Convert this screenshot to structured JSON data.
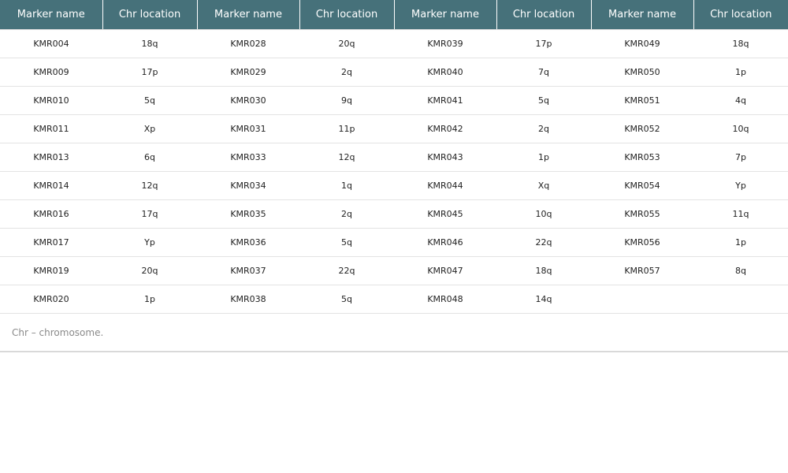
{
  "table": {
    "headers": [
      "Marker name",
      "Chr location",
      "Marker name",
      "Chr location",
      "Marker name",
      "Chr location",
      "Marker name",
      "Chr location"
    ],
    "rows": [
      [
        "KMR004",
        "18q",
        "KMR028",
        "20q",
        "KMR039",
        "17p",
        "KMR049",
        "18q"
      ],
      [
        "KMR009",
        "17p",
        "KMR029",
        "2q",
        "KMR040",
        "7q",
        "KMR050",
        "1p"
      ],
      [
        "KMR010",
        "5q",
        "KMR030",
        "9q",
        "KMR041",
        "5q",
        "KMR051",
        "4q"
      ],
      [
        "KMR011",
        "Xp",
        "KMR031",
        "11p",
        "KMR042",
        "2q",
        "KMR052",
        "10q"
      ],
      [
        "KMR013",
        "6q",
        "KMR033",
        "12q",
        "KMR043",
        "1p",
        "KMR053",
        "7p"
      ],
      [
        "KMR014",
        "12q",
        "KMR034",
        "1q",
        "KMR044",
        "Xq",
        "KMR054",
        "Yp"
      ],
      [
        "KMR016",
        "17q",
        "KMR035",
        "2q",
        "KMR045",
        "10q",
        "KMR055",
        "11q"
      ],
      [
        "KMR017",
        "Yp",
        "KMR036",
        "5q",
        "KMR046",
        "22q",
        "KMR056",
        "1p"
      ],
      [
        "KMR019",
        "20q",
        "KMR037",
        "22q",
        "KMR047",
        "18q",
        "KMR057",
        "8q"
      ],
      [
        "KMR020",
        "1p",
        "KMR038",
        "5q",
        "KMR048",
        "14q",
        "",
        ""
      ]
    ],
    "footnote": "Chr – chromosome.",
    "colors": {
      "header_bg": "#46717a",
      "header_text": "#ffffff",
      "footnote_text": "#8a8a8a"
    }
  }
}
